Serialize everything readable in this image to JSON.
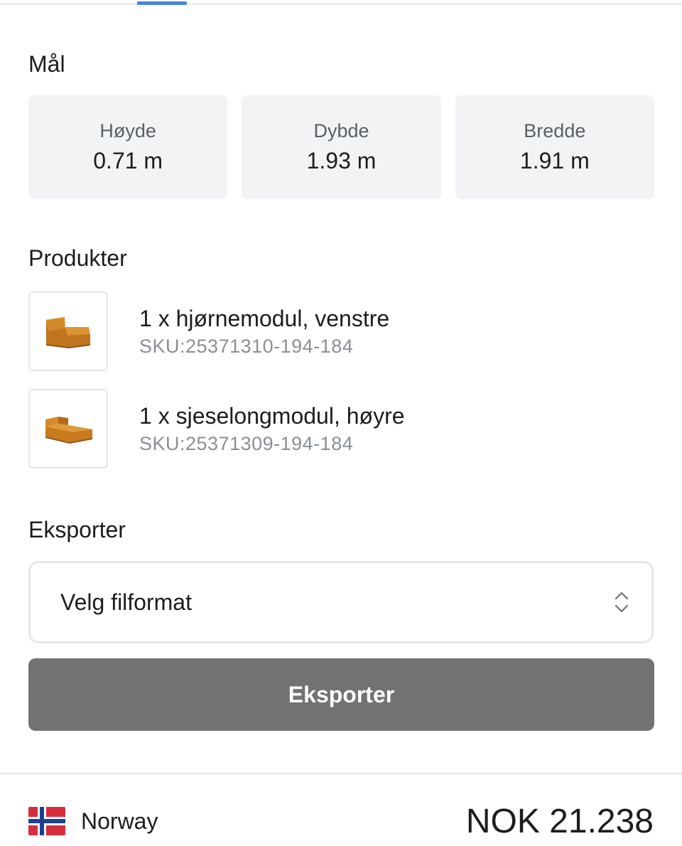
{
  "measurements": {
    "title": "Mål",
    "items": [
      {
        "label": "Høyde",
        "value": "0.71 m"
      },
      {
        "label": "Dybde",
        "value": "1.93 m"
      },
      {
        "label": "Bredde",
        "value": "1.91 m"
      }
    ]
  },
  "products": {
    "title": "Produkter",
    "items": [
      {
        "name": "1 x hjørnemodul, venstre",
        "sku": "SKU:25371310-194-184",
        "thumbnail": "corner-module-sofa-image"
      },
      {
        "name": "1 x sjeselongmodul, høyre",
        "sku": "SKU:25371309-194-184",
        "thumbnail": "chaise-module-sofa-image"
      }
    ]
  },
  "export": {
    "title": "Eksporter",
    "select_value": "Velg filformat",
    "button_label": "Eksporter"
  },
  "footer": {
    "country": "Norway",
    "flag": "norway-flag-icon",
    "price": "NOK 21.238"
  },
  "colors": {
    "accent": "#4a86d6",
    "button_bg": "#727272",
    "card_bg": "#f2f3f5",
    "sofa": "#c97a1e"
  }
}
